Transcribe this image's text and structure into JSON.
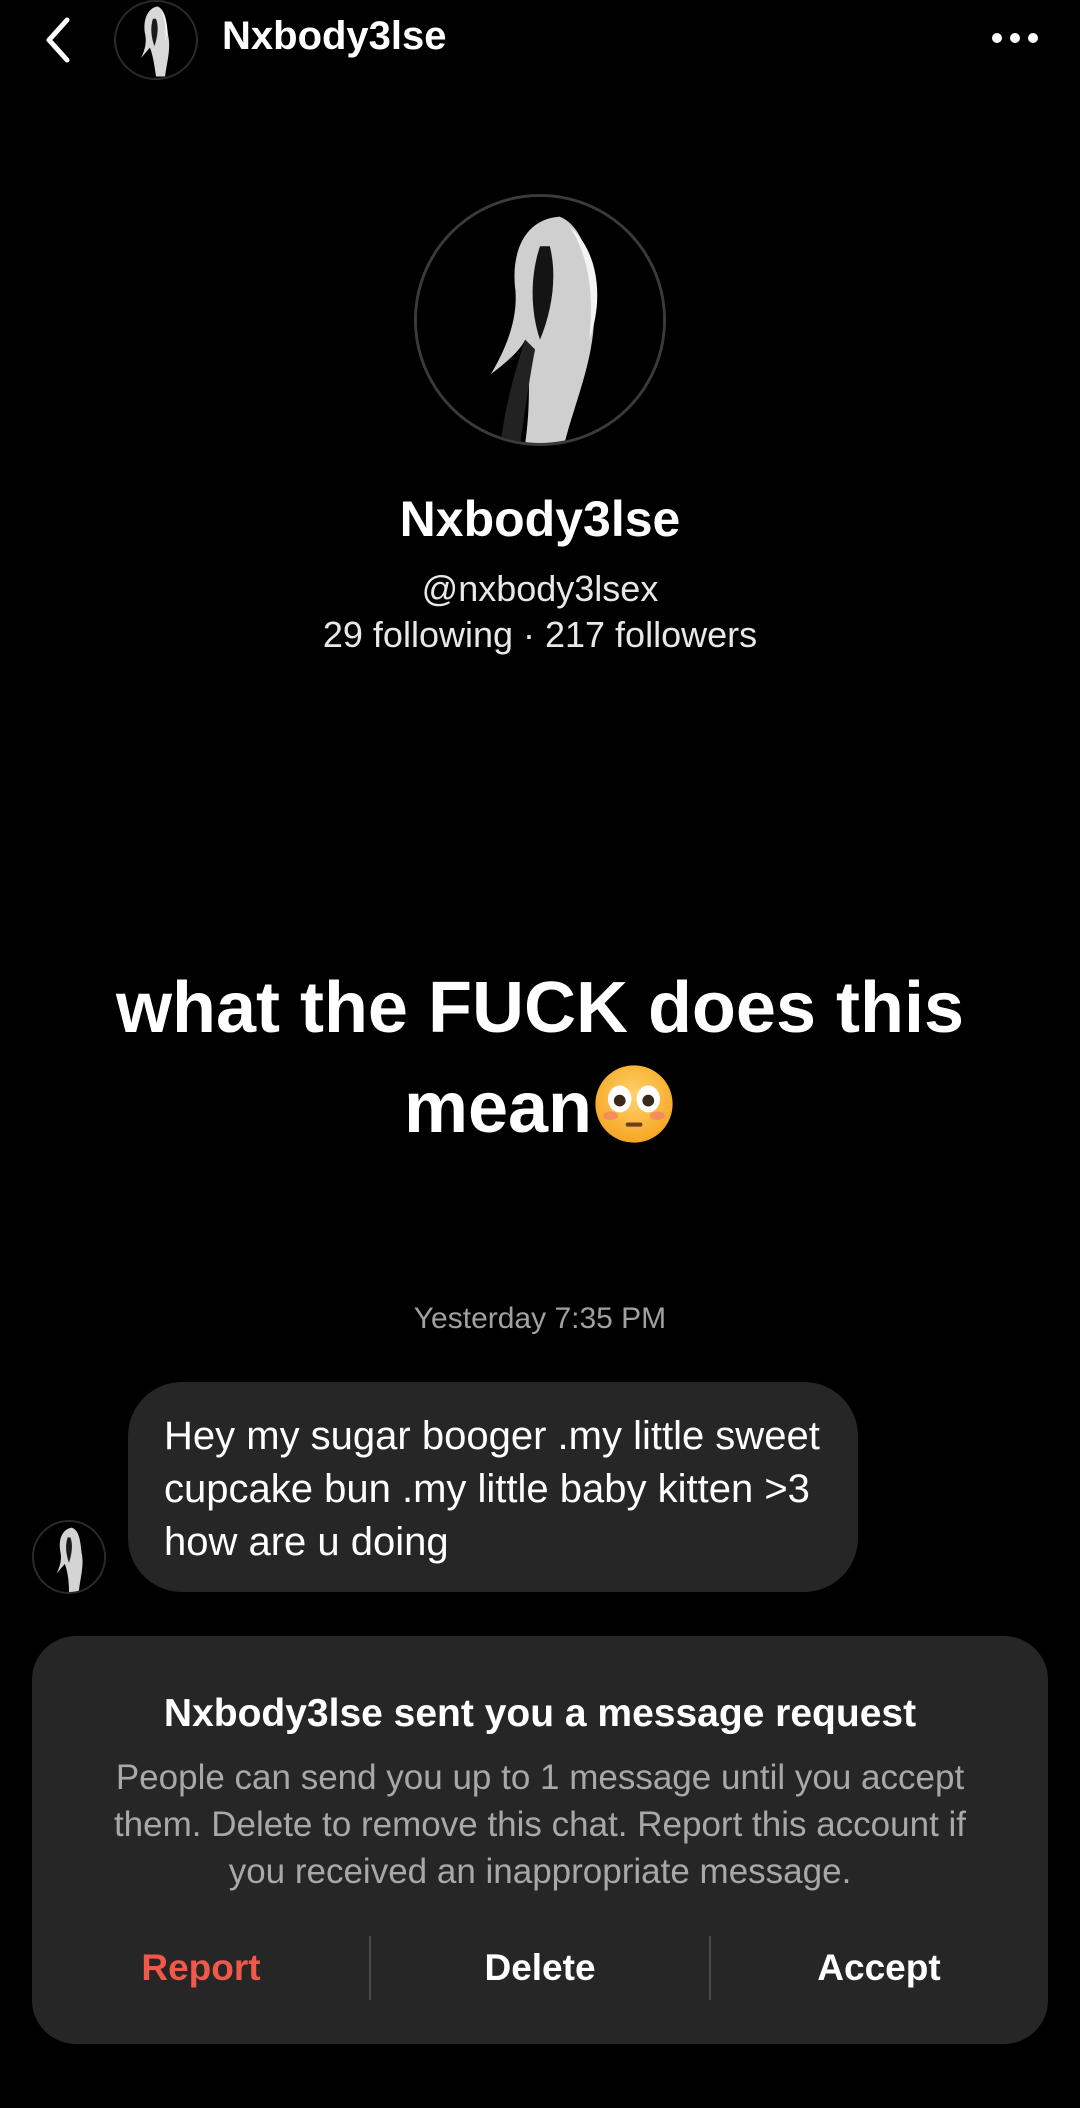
{
  "header": {
    "back_icon": "chevron-left-icon",
    "title": "Nxbody3lse",
    "more_icon": "more-horizontal-icon"
  },
  "profile": {
    "display_name": "Nxbody3lse",
    "handle": "@nxbody3lsex",
    "stats": "29 following · 217 followers"
  },
  "caption": {
    "text": "what the FUCK does this mean",
    "emoji": "flushed-face-emoji"
  },
  "conversation": {
    "timestamp": "Yesterday 7:35 PM",
    "messages": [
      {
        "text": "Hey my sugar booger .my little sweet cupcake bun .my little baby kitten >3 how are u doing"
      }
    ]
  },
  "request": {
    "title": "Nxbody3lse sent you a message request",
    "body": "People can send you up to 1 message until you accept them. Delete to remove this chat. Report this account if you received an inappropriate message.",
    "report_label": "Report",
    "delete_label": "Delete",
    "accept_label": "Accept"
  },
  "colors": {
    "background": "#000000",
    "bubble": "#262626",
    "report": "#f0584a",
    "muted_text": "#a8a8a8"
  }
}
